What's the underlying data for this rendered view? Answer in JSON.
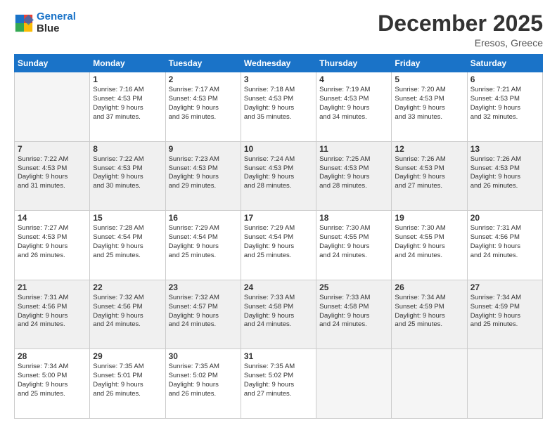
{
  "header": {
    "logo_line1": "General",
    "logo_line2": "Blue",
    "month": "December 2025",
    "location": "Eresos, Greece"
  },
  "days_of_week": [
    "Sunday",
    "Monday",
    "Tuesday",
    "Wednesday",
    "Thursday",
    "Friday",
    "Saturday"
  ],
  "weeks": [
    {
      "shaded": false,
      "days": [
        {
          "num": "",
          "info": ""
        },
        {
          "num": "1",
          "info": "Sunrise: 7:16 AM\nSunset: 4:53 PM\nDaylight: 9 hours\nand 37 minutes."
        },
        {
          "num": "2",
          "info": "Sunrise: 7:17 AM\nSunset: 4:53 PM\nDaylight: 9 hours\nand 36 minutes."
        },
        {
          "num": "3",
          "info": "Sunrise: 7:18 AM\nSunset: 4:53 PM\nDaylight: 9 hours\nand 35 minutes."
        },
        {
          "num": "4",
          "info": "Sunrise: 7:19 AM\nSunset: 4:53 PM\nDaylight: 9 hours\nand 34 minutes."
        },
        {
          "num": "5",
          "info": "Sunrise: 7:20 AM\nSunset: 4:53 PM\nDaylight: 9 hours\nand 33 minutes."
        },
        {
          "num": "6",
          "info": "Sunrise: 7:21 AM\nSunset: 4:53 PM\nDaylight: 9 hours\nand 32 minutes."
        }
      ]
    },
    {
      "shaded": true,
      "days": [
        {
          "num": "7",
          "info": "Sunrise: 7:22 AM\nSunset: 4:53 PM\nDaylight: 9 hours\nand 31 minutes."
        },
        {
          "num": "8",
          "info": "Sunrise: 7:22 AM\nSunset: 4:53 PM\nDaylight: 9 hours\nand 30 minutes."
        },
        {
          "num": "9",
          "info": "Sunrise: 7:23 AM\nSunset: 4:53 PM\nDaylight: 9 hours\nand 29 minutes."
        },
        {
          "num": "10",
          "info": "Sunrise: 7:24 AM\nSunset: 4:53 PM\nDaylight: 9 hours\nand 28 minutes."
        },
        {
          "num": "11",
          "info": "Sunrise: 7:25 AM\nSunset: 4:53 PM\nDaylight: 9 hours\nand 28 minutes."
        },
        {
          "num": "12",
          "info": "Sunrise: 7:26 AM\nSunset: 4:53 PM\nDaylight: 9 hours\nand 27 minutes."
        },
        {
          "num": "13",
          "info": "Sunrise: 7:26 AM\nSunset: 4:53 PM\nDaylight: 9 hours\nand 26 minutes."
        }
      ]
    },
    {
      "shaded": false,
      "days": [
        {
          "num": "14",
          "info": "Sunrise: 7:27 AM\nSunset: 4:53 PM\nDaylight: 9 hours\nand 26 minutes."
        },
        {
          "num": "15",
          "info": "Sunrise: 7:28 AM\nSunset: 4:54 PM\nDaylight: 9 hours\nand 25 minutes."
        },
        {
          "num": "16",
          "info": "Sunrise: 7:29 AM\nSunset: 4:54 PM\nDaylight: 9 hours\nand 25 minutes."
        },
        {
          "num": "17",
          "info": "Sunrise: 7:29 AM\nSunset: 4:54 PM\nDaylight: 9 hours\nand 25 minutes."
        },
        {
          "num": "18",
          "info": "Sunrise: 7:30 AM\nSunset: 4:55 PM\nDaylight: 9 hours\nand 24 minutes."
        },
        {
          "num": "19",
          "info": "Sunrise: 7:30 AM\nSunset: 4:55 PM\nDaylight: 9 hours\nand 24 minutes."
        },
        {
          "num": "20",
          "info": "Sunrise: 7:31 AM\nSunset: 4:56 PM\nDaylight: 9 hours\nand 24 minutes."
        }
      ]
    },
    {
      "shaded": true,
      "days": [
        {
          "num": "21",
          "info": "Sunrise: 7:31 AM\nSunset: 4:56 PM\nDaylight: 9 hours\nand 24 minutes."
        },
        {
          "num": "22",
          "info": "Sunrise: 7:32 AM\nSunset: 4:56 PM\nDaylight: 9 hours\nand 24 minutes."
        },
        {
          "num": "23",
          "info": "Sunrise: 7:32 AM\nSunset: 4:57 PM\nDaylight: 9 hours\nand 24 minutes."
        },
        {
          "num": "24",
          "info": "Sunrise: 7:33 AM\nSunset: 4:58 PM\nDaylight: 9 hours\nand 24 minutes."
        },
        {
          "num": "25",
          "info": "Sunrise: 7:33 AM\nSunset: 4:58 PM\nDaylight: 9 hours\nand 24 minutes."
        },
        {
          "num": "26",
          "info": "Sunrise: 7:34 AM\nSunset: 4:59 PM\nDaylight: 9 hours\nand 25 minutes."
        },
        {
          "num": "27",
          "info": "Sunrise: 7:34 AM\nSunset: 4:59 PM\nDaylight: 9 hours\nand 25 minutes."
        }
      ]
    },
    {
      "shaded": false,
      "days": [
        {
          "num": "28",
          "info": "Sunrise: 7:34 AM\nSunset: 5:00 PM\nDaylight: 9 hours\nand 25 minutes."
        },
        {
          "num": "29",
          "info": "Sunrise: 7:35 AM\nSunset: 5:01 PM\nDaylight: 9 hours\nand 26 minutes."
        },
        {
          "num": "30",
          "info": "Sunrise: 7:35 AM\nSunset: 5:02 PM\nDaylight: 9 hours\nand 26 minutes."
        },
        {
          "num": "31",
          "info": "Sunrise: 7:35 AM\nSunset: 5:02 PM\nDaylight: 9 hours\nand 27 minutes."
        },
        {
          "num": "",
          "info": ""
        },
        {
          "num": "",
          "info": ""
        },
        {
          "num": "",
          "info": ""
        }
      ]
    }
  ]
}
